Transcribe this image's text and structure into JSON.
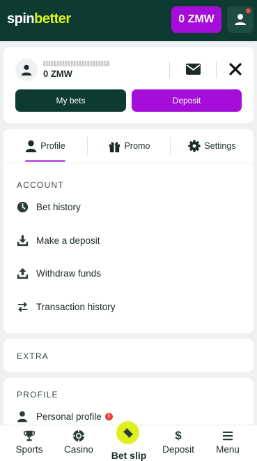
{
  "header": {
    "logo_spin": "spin",
    "logo_better": "better",
    "balance_button": "0 ZMW"
  },
  "account": {
    "balance": "0 ZMW",
    "my_bets_label": "My bets",
    "deposit_label": "Deposit"
  },
  "tabs": [
    {
      "label": "Profile",
      "icon": "person-icon",
      "active": true
    },
    {
      "label": "Promo",
      "icon": "gift-icon",
      "active": false
    },
    {
      "label": "Settings",
      "icon": "gear-icon",
      "active": false
    }
  ],
  "sections": {
    "account_title": "ACCOUNT",
    "account_items": [
      {
        "label": "Bet history",
        "icon": "clock-icon"
      },
      {
        "label": "Make a deposit",
        "icon": "download-icon"
      },
      {
        "label": "Withdraw funds",
        "icon": "upload-icon"
      },
      {
        "label": "Transaction history",
        "icon": "transfer-icon"
      }
    ],
    "extra_title": "EXTRA",
    "profile_title": "PROFILE",
    "profile_items": [
      {
        "label": "Personal profile",
        "icon": "person-icon",
        "warning": "!"
      }
    ]
  },
  "bottom_nav": {
    "sports": "Sports",
    "casino": "Casino",
    "bet_slip": "Bet slip",
    "deposit": "Deposit",
    "menu": "Menu"
  },
  "colors": {
    "brand_dark": "#0d3a31",
    "accent_purple": "#a50ed8",
    "logo_lime": "#d9f31b",
    "betslip_lime": "#dff021"
  }
}
